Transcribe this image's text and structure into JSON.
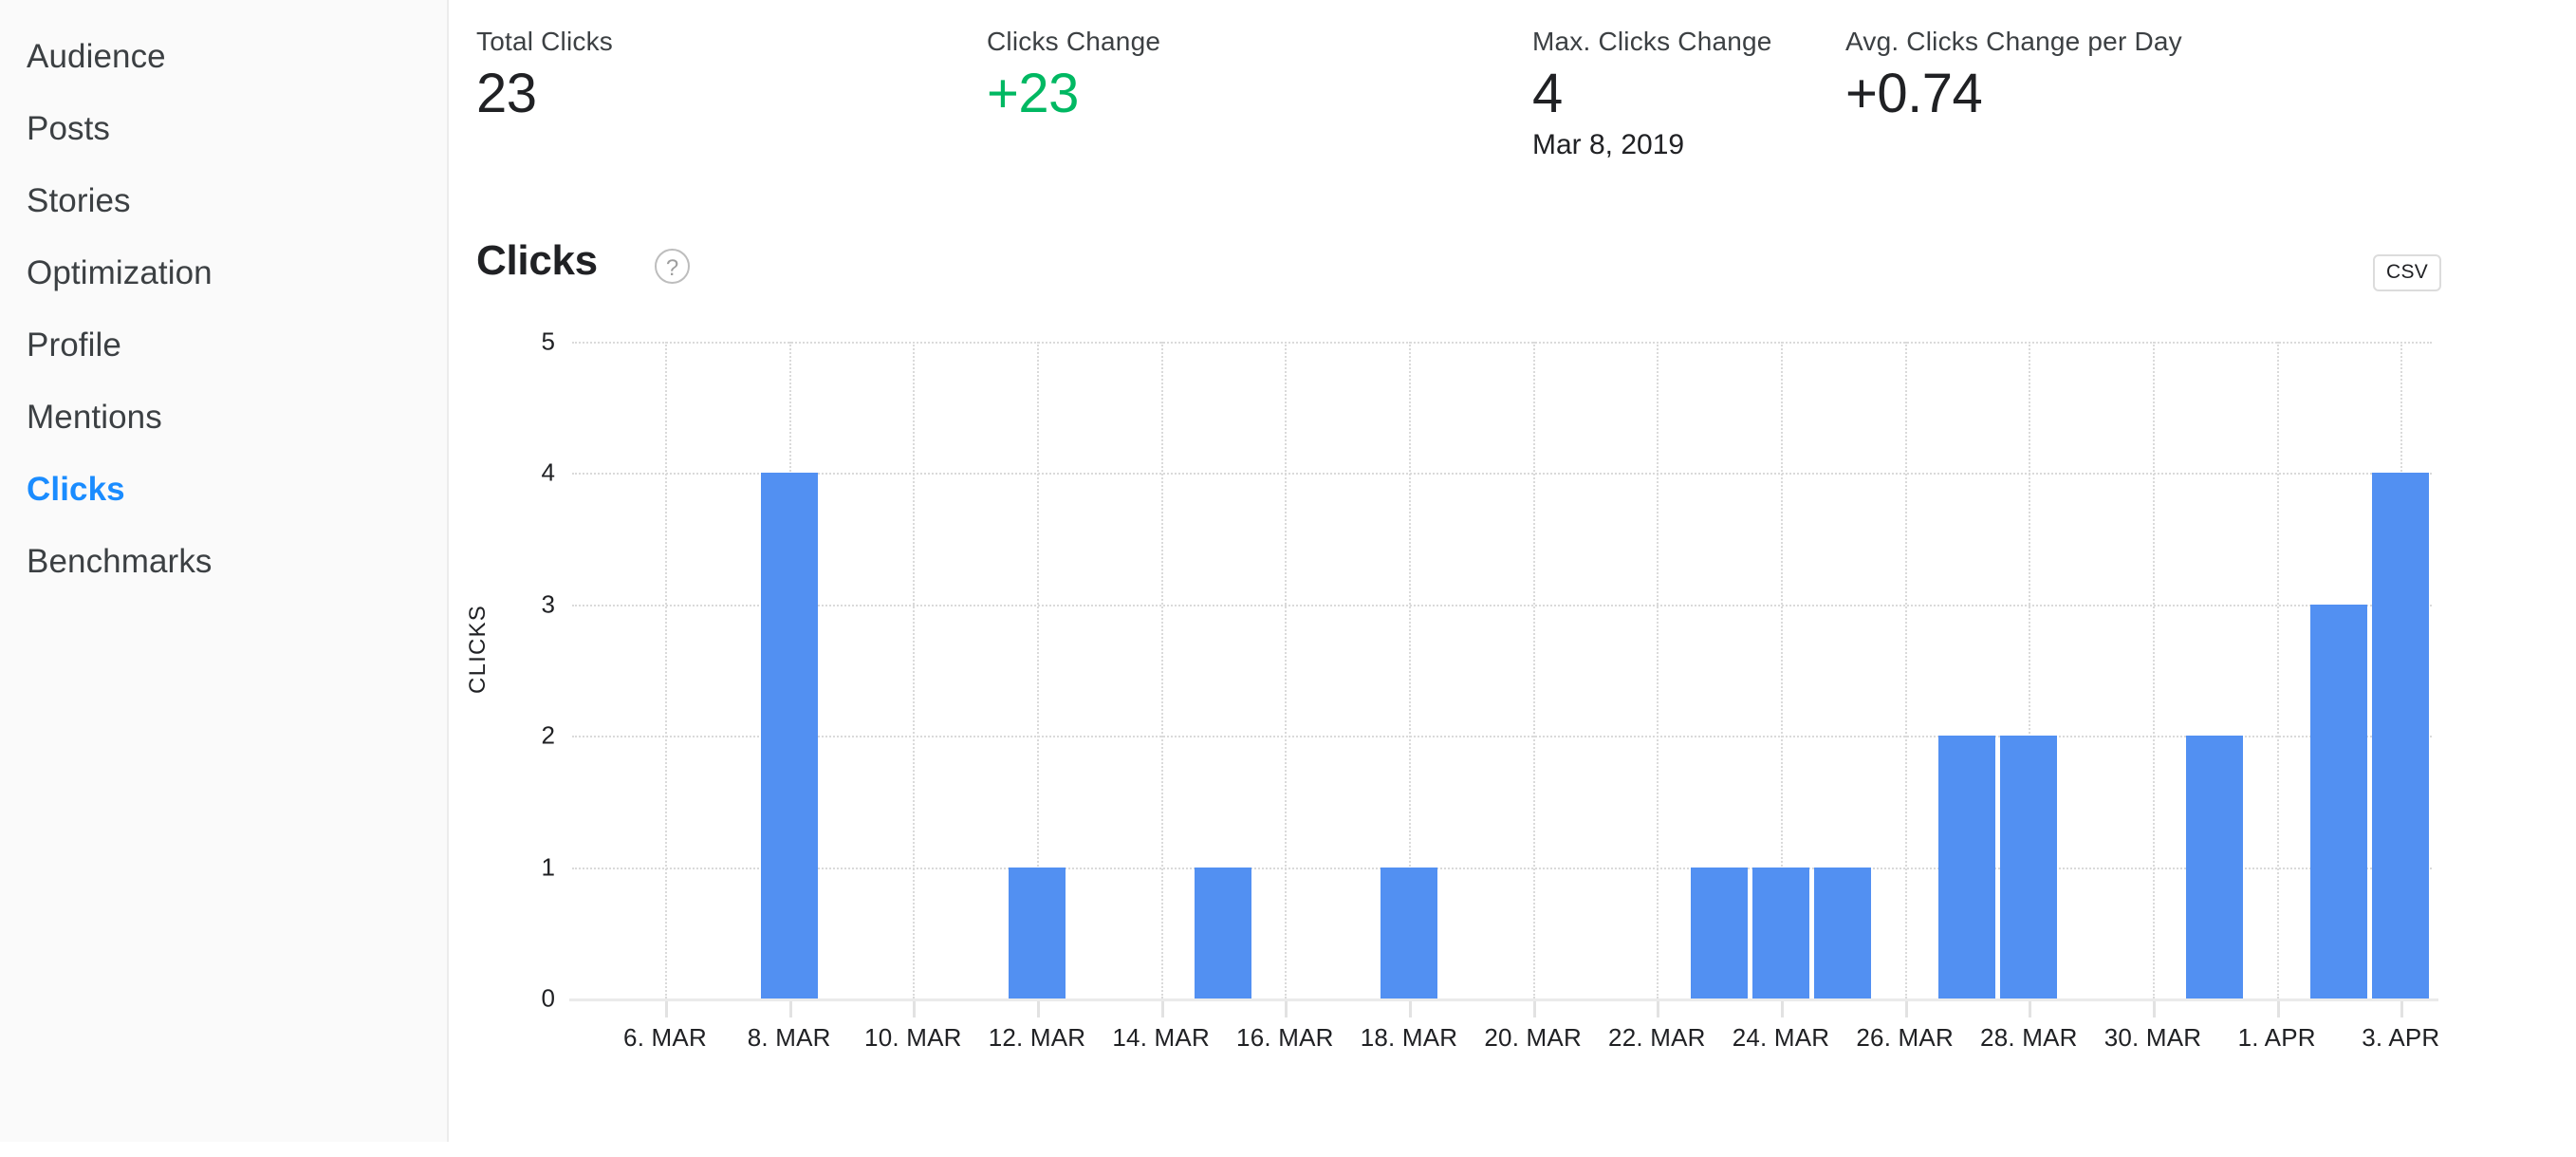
{
  "sidebar": {
    "items": [
      {
        "label": "Audience",
        "active": false
      },
      {
        "label": "Posts",
        "active": false
      },
      {
        "label": "Stories",
        "active": false
      },
      {
        "label": "Optimization",
        "active": false
      },
      {
        "label": "Profile",
        "active": false
      },
      {
        "label": "Mentions",
        "active": false
      },
      {
        "label": "Clicks",
        "active": true
      },
      {
        "label": "Benchmarks",
        "active": false
      }
    ],
    "active_color": "#1a8cff"
  },
  "stats": [
    {
      "label": "Total Clicks",
      "value": "23",
      "sub": "",
      "positive": false
    },
    {
      "label": "Clicks Change",
      "value": "+23",
      "sub": "",
      "positive": true
    },
    {
      "label": "Max. Clicks Change",
      "value": "4",
      "sub": "Mar 8, 2019",
      "positive": false
    },
    {
      "label": "Avg. Clicks Change per Day",
      "value": "+0.74",
      "sub": "",
      "positive": false
    }
  ],
  "card": {
    "title": "Clicks",
    "help_icon": "question-mark-icon",
    "csv_label": "CSV"
  },
  "chart_data": {
    "type": "bar",
    "title": "Clicks",
    "xlabel": "",
    "ylabel": "CLICKS",
    "ylim": [
      0,
      5
    ],
    "yticks": [
      "0",
      "1",
      "2",
      "3",
      "4",
      "5"
    ],
    "grid": true,
    "legend": false,
    "bar_color": "#5290f2",
    "x_tick_labels": [
      "6. MAR",
      "8. MAR",
      "10. MAR",
      "12. MAR",
      "14. MAR",
      "16. MAR",
      "18. MAR",
      "20. MAR",
      "22. MAR",
      "24. MAR",
      "26. MAR",
      "28. MAR",
      "30. MAR",
      "1. APR",
      "3. APR"
    ],
    "categories": [
      "5. MAR",
      "6. MAR",
      "7. MAR",
      "8. MAR",
      "9. MAR",
      "10. MAR",
      "11. MAR",
      "12. MAR",
      "13. MAR",
      "14. MAR",
      "15. MAR",
      "16. MAR",
      "17. MAR",
      "18. MAR",
      "19. MAR",
      "20. MAR",
      "21. MAR",
      "22. MAR",
      "23. MAR",
      "24. MAR",
      "25. MAR",
      "26. MAR",
      "27. MAR",
      "28. MAR",
      "29. MAR",
      "30. MAR",
      "31. MAR",
      "1. APR",
      "2. APR",
      "3. APR"
    ],
    "values": [
      0,
      0,
      0,
      4,
      0,
      0,
      0,
      1,
      0,
      0,
      1,
      0,
      0,
      1,
      0,
      0,
      0,
      0,
      1,
      1,
      1,
      0,
      2,
      2,
      0,
      0,
      2,
      0,
      3,
      4
    ]
  }
}
